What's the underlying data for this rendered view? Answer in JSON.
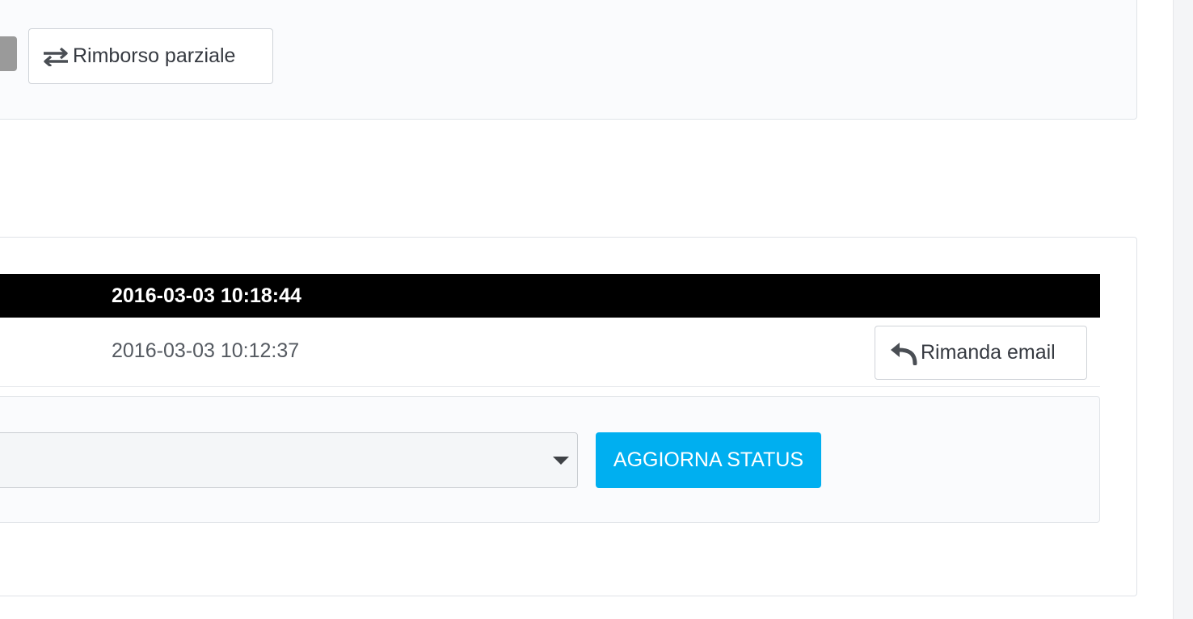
{
  "actions": {
    "partial_refund_label": "Rimborso parziale"
  },
  "history": {
    "rows": [
      {
        "date": "2016-03-03 10:18:44",
        "highlighted": true
      },
      {
        "date": "2016-03-03 10:12:37",
        "highlighted": false,
        "action_label": "Rimanda email"
      }
    ]
  },
  "status_form": {
    "selected_status": "",
    "submit_label": "AGGIORNA STATUS"
  },
  "colors": {
    "primary": "#00aff0",
    "active_row": "#000000",
    "panel_bg": "#fafbfd"
  },
  "icons": {
    "refund": "exchange-arrows-icon",
    "resend": "reply-arrow-icon",
    "select": "caret-down-icon"
  }
}
